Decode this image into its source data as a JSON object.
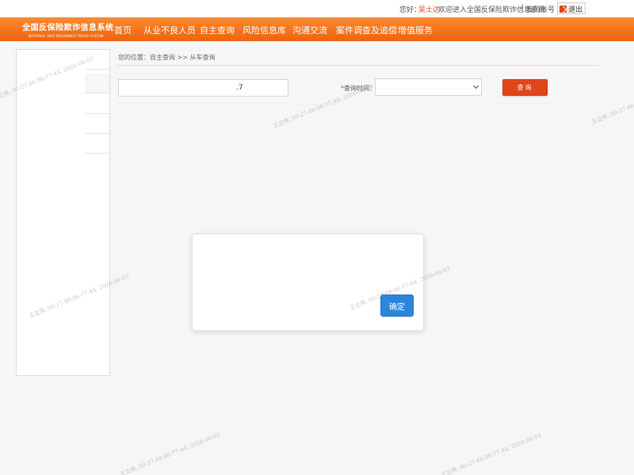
{
  "topbar": {
    "greeting": "您好：",
    "user": "吴士达",
    "welcome": "欢迎进入全国反保险欺诈信息系统",
    "separator": "|",
    "account": "我的账号",
    "logout": "退出"
  },
  "logo": {
    "title": "全国反保险欺诈信息系统",
    "subtitle": "NATIONAL ANTI INSURANCE FRAUD SYSTEM"
  },
  "nav": {
    "items": [
      {
        "label": "首页"
      },
      {
        "label": "从业不良人员"
      },
      {
        "label": "自主查询"
      },
      {
        "label": "风险信息库"
      },
      {
        "label": "沟通交流"
      },
      {
        "label": "案件调查及追偿"
      },
      {
        "label": "增值服务"
      }
    ]
  },
  "breadcrumb": "您的位置：自主查询 >> 从车查询",
  "form": {
    "plate_value": ".7",
    "time_required_mark": "*",
    "time_label": "查询时间：",
    "time_selected": "",
    "query_label": "查询"
  },
  "modal": {
    "confirm_label": "确定"
  },
  "watermark": {
    "text": "王立伟, 00-27-88-86-77-44, 2026-08-03"
  }
}
